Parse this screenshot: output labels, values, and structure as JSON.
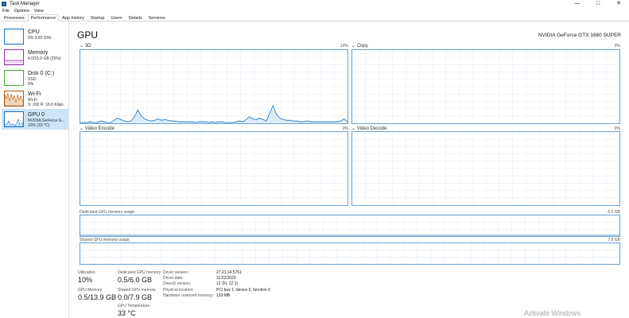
{
  "window": {
    "title": "Task Manager",
    "controls": {
      "minimize": "—",
      "maximize": "□",
      "close": "✕"
    }
  },
  "menu": [
    "File",
    "Options",
    "View"
  ],
  "tabs": [
    "Processes",
    "Performance",
    "App history",
    "Startup",
    "Users",
    "Details",
    "Services"
  ],
  "active_tab": "Performance",
  "sidebar": {
    "items": [
      {
        "title": "CPU",
        "sub1": "5%  3.90 GHz",
        "sub2": "",
        "color": "#1b76c4"
      },
      {
        "title": "Memory",
        "sub1": "4.0/15.9 GB (25%)",
        "sub2": "",
        "color": "#9b2fae"
      },
      {
        "title": "Disk 0 (C:)",
        "sub1": "SSD",
        "sub2": "0%",
        "color": "#4fa53a"
      },
      {
        "title": "Wi-Fi",
        "sub1": "Wi-Fi",
        "sub2": "S: 200  R: 16.0 Kbps",
        "color": "#b4621a"
      },
      {
        "title": "GPU 0",
        "sub1": "NVIDIA GeForce G...",
        "sub2": "10% (33 °C)",
        "color": "#1b76c4"
      }
    ],
    "selected_index": 4
  },
  "main": {
    "title": "GPU",
    "gpu_name": "NVIDIA GeForce GTX 1660 SUPER",
    "engines": [
      {
        "name": "3D",
        "pct": "10%"
      },
      {
        "name": "Copy",
        "pct": "0%"
      },
      {
        "name": "Video Encode",
        "pct": "0%"
      },
      {
        "name": "Video Decode",
        "pct": "0%"
      }
    ],
    "dedicated_label": "Dedicated GPU memory usage",
    "dedicated_max": "6.0 GB",
    "shared_label": "Shared GPU memory usage",
    "shared_max": "7.9 GB"
  },
  "stats": {
    "utilization": {
      "label": "Utilization",
      "value": "10%"
    },
    "dedicated": {
      "label": "Dedicated GPU memory",
      "value": "0.5/6.0 GB"
    },
    "gpu_memory": {
      "label": "GPU Memory",
      "value": "0.5/13.9 GB"
    },
    "shared": {
      "label": "Shared GPU memory",
      "value": "0.0/7.9 GB"
    },
    "temperature": {
      "label": "GPU Temperature",
      "value": "33 °C"
    }
  },
  "info": [
    {
      "label": "Driver version:",
      "value": "27.21.14.5751"
    },
    {
      "label": "Driver date:",
      "value": "11/22/2020"
    },
    {
      "label": "DirectX version:",
      "value": "12 (FL 12.1)"
    },
    {
      "label": "Physical location:",
      "value": "PCI bus 1, device 0, function 0"
    },
    {
      "label": "Hardware reserved memory:",
      "value": "133 MB"
    }
  ],
  "watermark": "Activate Windows",
  "chart_data": {
    "type": "area",
    "series": [
      {
        "name": "3D",
        "values": [
          1,
          1,
          1,
          2,
          1,
          1,
          3,
          2,
          1,
          1,
          4,
          7,
          5,
          3,
          2,
          3,
          9,
          18,
          10,
          6,
          4,
          3,
          4,
          6,
          4,
          5,
          4,
          3,
          3,
          2,
          2,
          2,
          2,
          2,
          1,
          2,
          2,
          2,
          1,
          2,
          1,
          2,
          2,
          1,
          1,
          1,
          2,
          3,
          2,
          5,
          9,
          6,
          5,
          7,
          5,
          3,
          14,
          24,
          12,
          7,
          5,
          4,
          4,
          3,
          3,
          2,
          2,
          3,
          2,
          2,
          2,
          2,
          2,
          2,
          2,
          2,
          2,
          3,
          6,
          2
        ]
      }
    ],
    "ylim": [
      0,
      100
    ],
    "dedicated_memory_fraction": 0.083,
    "shared_memory_fraction": 0.0
  }
}
